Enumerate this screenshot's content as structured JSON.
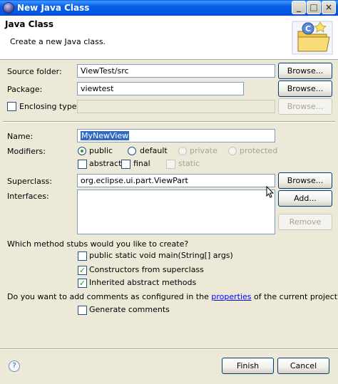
{
  "window": {
    "title": "New Java Class",
    "minimize_glyph": "_",
    "maximize_glyph": "□",
    "close_glyph": "×"
  },
  "header": {
    "title": "Java Class",
    "subtitle": "Create a new Java class."
  },
  "form": {
    "source_folder": {
      "label": "Source folder:",
      "value": "ViewTest/src",
      "button": "Browse..."
    },
    "package": {
      "label": "Package:",
      "value": "viewtest",
      "button": "Browse..."
    },
    "enclosing_type": {
      "label": "Enclosing type:",
      "value": "",
      "button": "Browse...",
      "checked": false
    },
    "name": {
      "label": "Name:",
      "value": "MyNewView"
    },
    "modifiers": {
      "label": "Modifiers:",
      "access": [
        "public",
        "default",
        "private",
        "protected"
      ],
      "selected": "public",
      "extra": [
        "abstract",
        "final",
        "static"
      ]
    },
    "superclass": {
      "label": "Superclass:",
      "value": "org.eclipse.ui.part.ViewPart",
      "button": "Browse..."
    },
    "interfaces": {
      "label": "Interfaces:",
      "add_button": "Add...",
      "remove_button": "Remove"
    },
    "stubs": {
      "question": "Which method stubs would you like to create?",
      "items": [
        {
          "label": "public static void main(String[] args)",
          "checked": false
        },
        {
          "label": "Constructors from superclass",
          "checked": true
        },
        {
          "label": "Inherited abstract methods",
          "checked": true
        }
      ]
    },
    "comments": {
      "question_prefix": "Do you want to add comments as configured in the ",
      "question_link": "properties",
      "question_suffix": " of the current project?",
      "option": "Generate comments",
      "checked": false
    }
  },
  "footer": {
    "help_glyph": "?",
    "finish": "Finish",
    "cancel": "Cancel"
  },
  "colors": {
    "titlebar": "#0054e3",
    "dialog_bg": "#ece9d8",
    "link": "#0000ff",
    "check": "#21a121"
  }
}
